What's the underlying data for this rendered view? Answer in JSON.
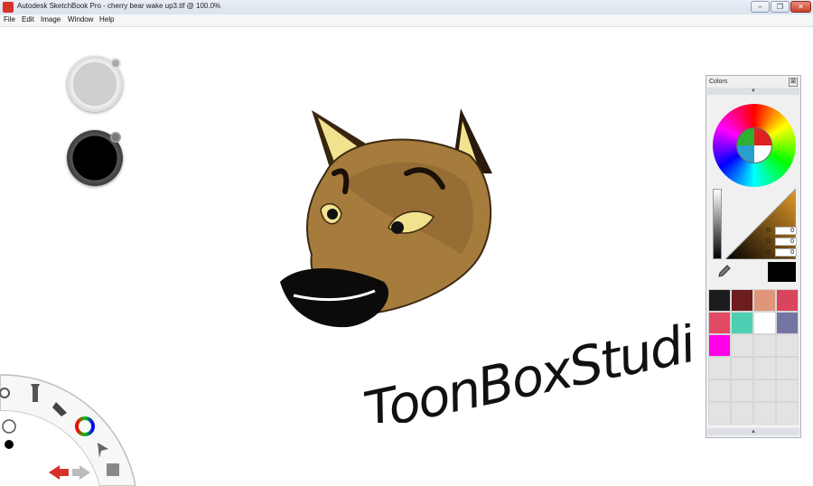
{
  "window": {
    "title": "Autodesk SketchBook Pro - cherry bear wake up3.tif @ 100.0%",
    "minimize_glyph": "–",
    "maximize_glyph": "❐",
    "close_glyph": "✕"
  },
  "menu": {
    "items": [
      "File",
      "Edit",
      "Image",
      "Window",
      "Help"
    ]
  },
  "canvas": {
    "signature": "ToonBoxStudio.com"
  },
  "colors_panel": {
    "title": "Colors",
    "close_glyph": "⊠",
    "collapse_glyph": "▼",
    "expand_glyph": "▲",
    "rgb": [
      {
        "label": "R:",
        "value": "0"
      },
      {
        "label": "G:",
        "value": "0"
      },
      {
        "label": "B:",
        "value": "0"
      }
    ],
    "current_color": "#000000",
    "swatches": [
      "#1c1c1c",
      "#6e1d1f",
      "#e0967a",
      "#d8455c",
      "#e24a63",
      "#4dcfb4",
      "#ffffff",
      "#7476a1",
      "#ff00e6",
      "",
      "",
      "",
      "",
      "",
      "",
      "",
      "",
      "",
      "",
      "",
      "",
      "",
      "",
      ""
    ]
  },
  "brushes": {
    "size_color": "#c8c8c8",
    "color_puck": "#000000"
  }
}
